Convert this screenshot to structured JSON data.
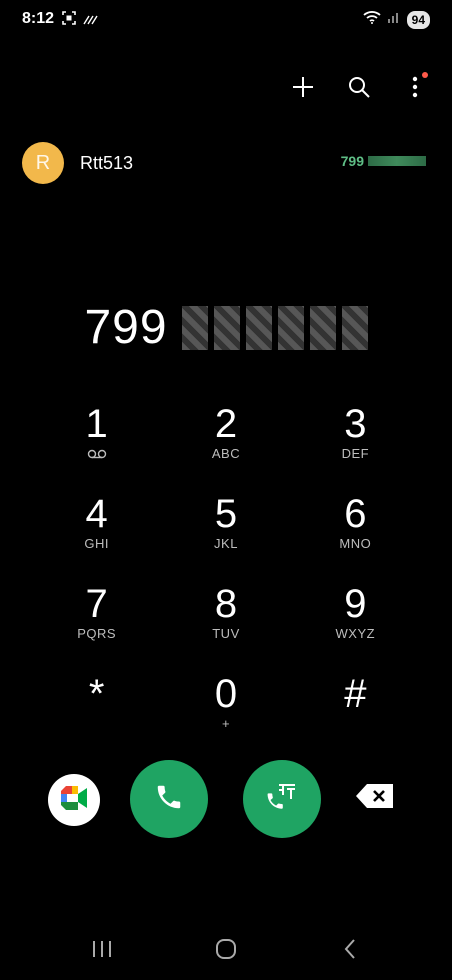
{
  "status": {
    "time": "8:12",
    "battery": "94"
  },
  "toolbar": {
    "icons": [
      "add-icon",
      "search-icon",
      "more-vert-icon"
    ]
  },
  "suggestion": {
    "avatar_letter": "R",
    "name": "Rtt513",
    "number_match": "799"
  },
  "dialed": {
    "visible_digits": "799"
  },
  "keypad": [
    {
      "digit": "1",
      "sub": ""
    },
    {
      "digit": "2",
      "sub": "ABC"
    },
    {
      "digit": "3",
      "sub": "DEF"
    },
    {
      "digit": "4",
      "sub": "GHI"
    },
    {
      "digit": "5",
      "sub": "JKL"
    },
    {
      "digit": "6",
      "sub": "MNO"
    },
    {
      "digit": "7",
      "sub": "PQRS"
    },
    {
      "digit": "8",
      "sub": "TUV"
    },
    {
      "digit": "9",
      "sub": "WXYZ"
    },
    {
      "digit": "*",
      "sub": ""
    },
    {
      "digit": "0",
      "sub": "+"
    },
    {
      "digit": "#",
      "sub": ""
    }
  ],
  "colors": {
    "call_green": "#1fa463",
    "avatar": "#f2b84b",
    "match_green": "#5fbe86"
  }
}
